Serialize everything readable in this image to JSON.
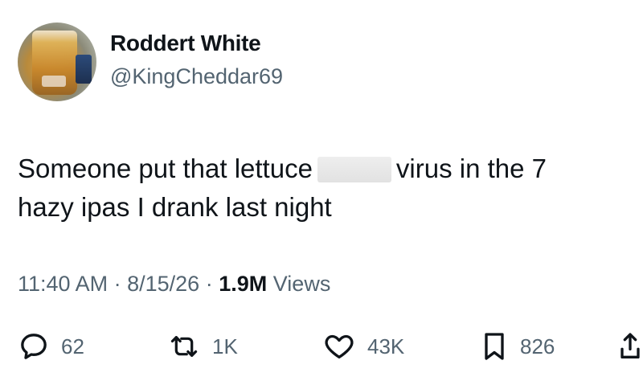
{
  "author": {
    "name": "Roddert White",
    "handle": "@KingCheddar69"
  },
  "tweet": {
    "line1_before": "Someone put that lettuce",
    "line1_after": "virus in the 7",
    "line2": "hazy ipas I drank last night"
  },
  "meta": {
    "time": "11:40 AM",
    "sep1": "·",
    "date": "8/15/26",
    "sep2": "·",
    "views_count": "1.9M",
    "views_label": "Views"
  },
  "actions": {
    "replies": "62",
    "reposts": "1K",
    "likes": "43K",
    "bookmarks": "826"
  },
  "colors": {
    "text": "#0f1419",
    "secondary": "#536471",
    "background": "#ffffff"
  },
  "icons": [
    "reply-icon",
    "repost-icon",
    "like-icon",
    "bookmark-icon",
    "share-icon"
  ]
}
